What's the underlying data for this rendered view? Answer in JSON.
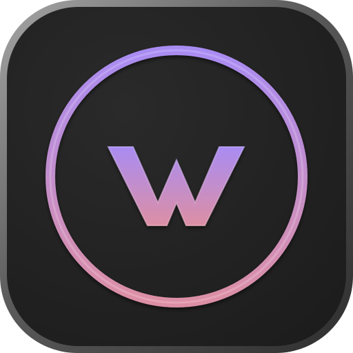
{
  "app_icon": {
    "logo_letter": "W",
    "colors": {
      "bezel_light": "#9a9a9a",
      "bezel_dark": "#3a3a3a",
      "face": "#222222",
      "face_highlight": "#2c2c2c",
      "gradient_top": "#a98cf2",
      "gradient_bottom": "#d98fa6"
    },
    "icon_name": "w-ring-logo-icon"
  }
}
